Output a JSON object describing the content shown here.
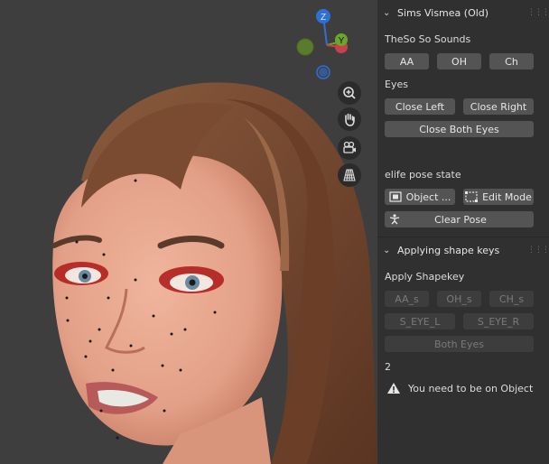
{
  "gizmo": {
    "z": "Z",
    "y": "Y"
  },
  "panel1": {
    "title": "Sims Vismea (Old)",
    "sounds_label": "TheSo So Sounds",
    "sounds": [
      "AA",
      "OH",
      "Ch"
    ],
    "eyes_label": "Eyes",
    "close_left": "Close Left",
    "close_right": "Close Right",
    "close_both": "Close Both Eyes",
    "pose_label": "elife pose state",
    "object_mode": "Object ...",
    "edit_mode": "Edit Mode",
    "clear_pose": "Clear Pose"
  },
  "panel2": {
    "title": "Applying shape keys",
    "apply_label": "Apply Shapekey",
    "keys_row1": [
      "AA_s",
      "OH_s",
      "CH_s"
    ],
    "keys_row2": [
      "S_EYE_L",
      "S_EYE_R"
    ],
    "both_eyes": "Both Eyes",
    "count": "2",
    "warning": "You need to be on Object"
  },
  "icons": {
    "viewport": [
      "zoom-icon",
      "hand-pan-icon",
      "camera-icon",
      "grid-perspective-icon"
    ],
    "warning": "warning-icon"
  },
  "colors": {
    "gizmo_z": "#2f6fd6",
    "gizmo_y": "#6aa629",
    "gizmo_x": "#c7404c",
    "button": "#545454",
    "panel": "#303030"
  }
}
